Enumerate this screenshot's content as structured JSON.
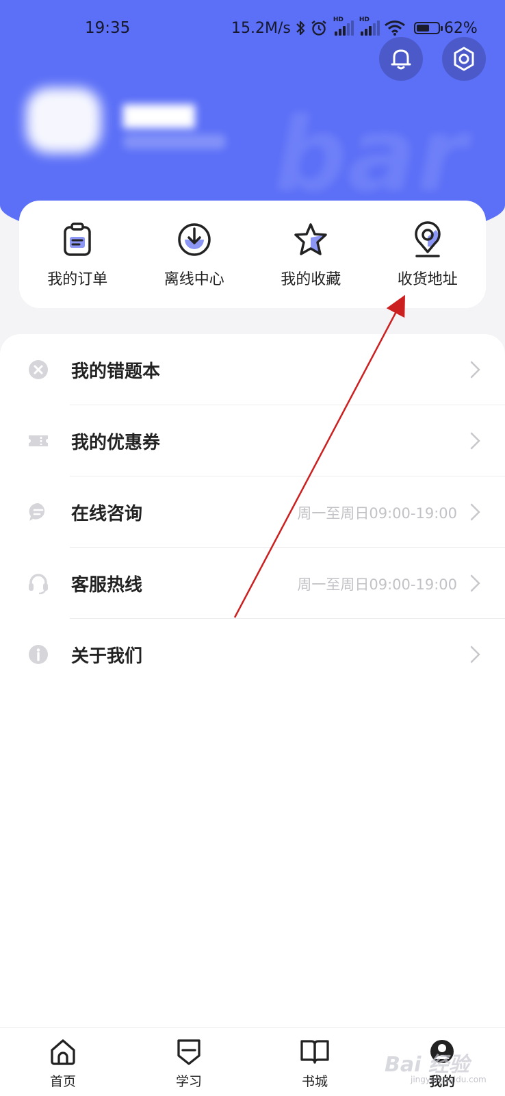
{
  "status_bar": {
    "time": "19:35",
    "net_speed": "15.2M/s",
    "sim1_label": "HD",
    "sim2_label": "HD",
    "battery_level": 0.62,
    "battery_text": "62%"
  },
  "header": {
    "background_color": "#5b6ff7",
    "icons": [
      "bell-icon",
      "gear-icon"
    ]
  },
  "quick_actions": [
    {
      "label": "我的订单",
      "icon": "order-clipboard-icon"
    },
    {
      "label": "离线中心",
      "icon": "download-icon"
    },
    {
      "label": "我的收藏",
      "icon": "star-icon"
    },
    {
      "label": "收货地址",
      "icon": "location-pin-icon"
    }
  ],
  "menu": [
    {
      "label": "我的错题本",
      "hint": "",
      "icon": "close-circle-icon"
    },
    {
      "label": "我的优惠券",
      "hint": "",
      "icon": "ticket-icon"
    },
    {
      "label": "在线咨询",
      "hint": "周一至周日09:00-19:00",
      "icon": "chat-bubble-icon"
    },
    {
      "label": "客服热线",
      "hint": "周一至周日09:00-19:00",
      "icon": "headset-icon"
    },
    {
      "label": "关于我们",
      "hint": "",
      "icon": "info-icon"
    }
  ],
  "tabbar": [
    {
      "label": "首页",
      "icon": "home-icon",
      "active": false
    },
    {
      "label": "学习",
      "icon": "study-shield-icon",
      "active": false
    },
    {
      "label": "书城",
      "icon": "book-icon",
      "active": false
    },
    {
      "label": "我的",
      "icon": "profile-icon",
      "active": true
    }
  ],
  "annotation": {
    "color": "#cc1f1f",
    "points_to": "收货地址"
  },
  "watermark": {
    "text": "Bai 经验",
    "sub": "jingyan.baidu.com"
  }
}
